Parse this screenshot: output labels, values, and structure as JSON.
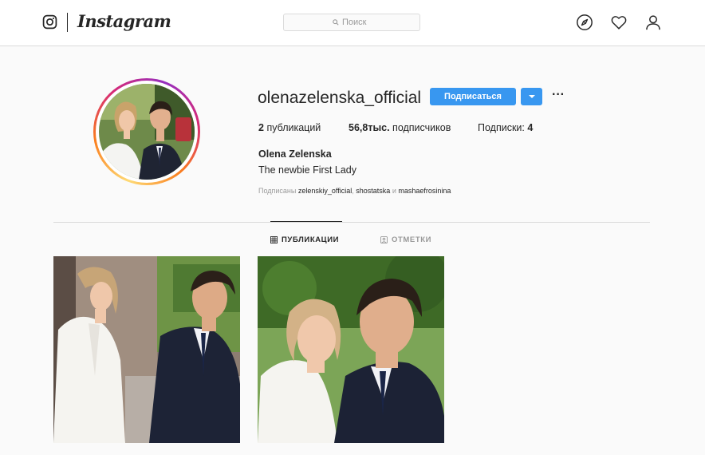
{
  "app": {
    "wordmark": "Instagram",
    "logo_icon": "instagram-camera-icon"
  },
  "search": {
    "placeholder": "Поиск",
    "icon": "search-icon"
  },
  "nav": {
    "icons": [
      "compass-icon",
      "heart-icon",
      "user-icon"
    ]
  },
  "profile": {
    "username": "olenazelenska_official",
    "follow_label": "Подписаться",
    "more_label": "···",
    "posts_count": "2",
    "posts_label": "публикаций",
    "followers_count": "56,8тыс.",
    "followers_label": "подписчиков",
    "following_label": "Подписки:",
    "following_count": "4",
    "full_name": "Olena Zelenska",
    "bio": "The newbie First Lady",
    "followed_by_label": "Подписаны",
    "followed_by_1": "zelenskiy_official",
    "followed_by_2": "shostatska",
    "followed_by_and": "и",
    "followed_by_3": "mashaefrosinina"
  },
  "tabs": [
    {
      "label": "ПУБЛИКАЦИИ",
      "icon": "grid-icon",
      "active": true
    },
    {
      "label": "ОТМЕТКИ",
      "icon": "tag-icon",
      "active": false
    }
  ],
  "colors": {
    "accent": "#3897f0",
    "text": "#262626",
    "muted": "#999999",
    "border": "#dbdbdb",
    "background": "#fafafa"
  }
}
